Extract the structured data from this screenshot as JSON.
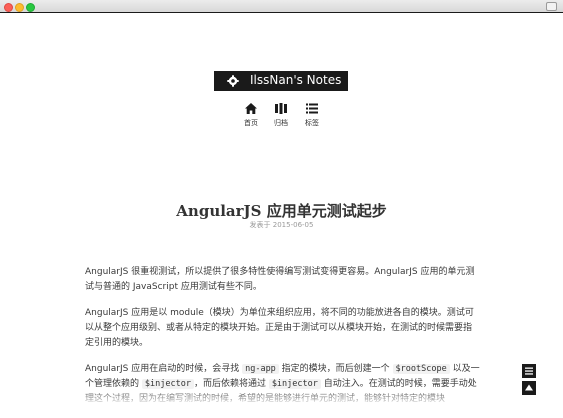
{
  "site": {
    "title": "IlssNan's Notes"
  },
  "nav": {
    "items": [
      {
        "label": "首页",
        "icon": "home-icon"
      },
      {
        "label": "归档",
        "icon": "archive-icon"
      },
      {
        "label": "标签",
        "icon": "tags-list-icon"
      }
    ]
  },
  "post": {
    "title": "AngularJS 应用单元测试起步",
    "meta": "发表于 2015-06-05",
    "paragraphs": [
      {
        "segments": [
          {
            "text": "AngularJS 很重视测试，所以提供了很多特性使得编写测试变得更容易。AngularJS 应用的单元测试与普通的 JavaScript 应用测试有些不同。",
            "code": false
          }
        ]
      },
      {
        "segments": [
          {
            "text": "AngularJS 应用是以 module（模块）为单位来组织应用，将不同的功能放进各自的模块。测试可以从整个应用级别、或者从特定的模块开始。正是由于测试可以从模块开始，在测试的时候需要指定引用的模块。",
            "code": false
          }
        ]
      },
      {
        "segments": [
          {
            "text": "AngularJS 应用在启动的时候，会寻找 ",
            "code": false
          },
          {
            "text": "ng-app",
            "code": true
          },
          {
            "text": " 指定的模块，而后创建一个 ",
            "code": false
          },
          {
            "text": "$rootScope",
            "code": true
          },
          {
            "text": " 以及一个管理依赖的 ",
            "code": false
          },
          {
            "text": "$injector",
            "code": true
          },
          {
            "text": "，而后依赖将通过 ",
            "code": false
          },
          {
            "text": "$injector",
            "code": true
          },
          {
            "text": " 自动注入。在测试的时候，需要手动处理这个过程，因为在编写测试的时候，希望的是能够进行单元的测试，能够针对特定的模块",
            "code": false
          }
        ]
      }
    ]
  },
  "floating": [
    {
      "icon": "toc-list-icon"
    },
    {
      "icon": "back-to-top-icon"
    }
  ],
  "colors": {
    "accent": "#1a1a1a",
    "text": "#333333",
    "meta": "#9a9a9a",
    "code_bg": "#f2f2f2"
  }
}
